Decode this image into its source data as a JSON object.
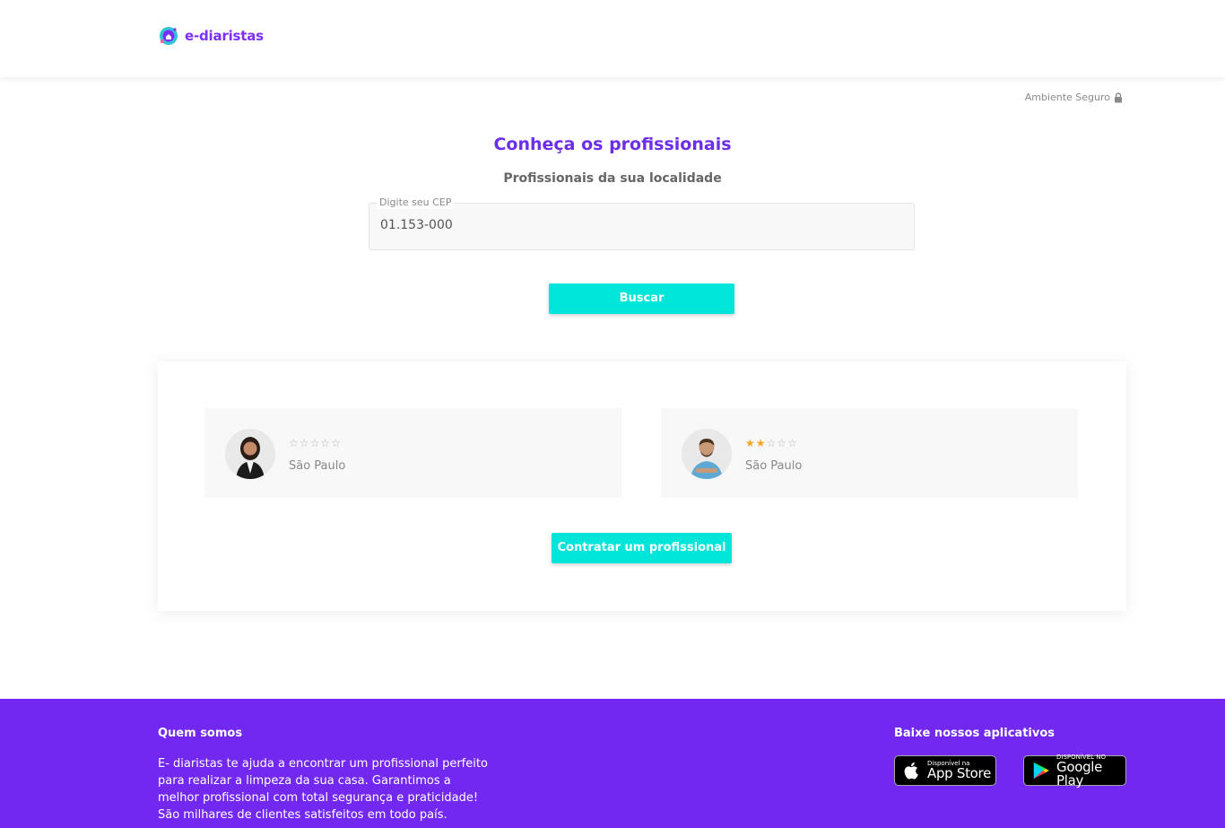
{
  "header": {
    "brand": "e-diaristas"
  },
  "secure": {
    "label": "Ambiente Seguro",
    "icon": "lock-icon"
  },
  "main": {
    "title": "Conheça os profissionais",
    "subtitle": "Profissionais da sua localidade",
    "cep": {
      "label": "Digite seu CEP",
      "value": "01.153-000"
    },
    "search_label": "Buscar"
  },
  "professionals": [
    {
      "rating": 0,
      "max_rating": 5,
      "city": "São Paulo"
    },
    {
      "rating": 2,
      "max_rating": 5,
      "city": "São Paulo"
    }
  ],
  "hire_label": "Contratar um profissional",
  "footer": {
    "about_title": "Quem somos",
    "about_lines": [
      "E- diaristas te ajuda a encontrar um profissional perfeito",
      "para realizar a limpeza da sua casa. Garantimos a",
      "melhor profissional com total segurança e praticidade!",
      "São milhares de clientes satisfeitos em todo país."
    ],
    "apps_title": "Baixe nossos aplicativos",
    "app_store": {
      "small": "Disponível na",
      "big": "App Store"
    },
    "google_play": {
      "small": "DISPONÍVEL NO",
      "big": "Google Play"
    }
  },
  "colors": {
    "brand": "#7b2ff7",
    "accent": "#00e5d9",
    "footer": "#7328f0",
    "star": "#f5a623"
  }
}
